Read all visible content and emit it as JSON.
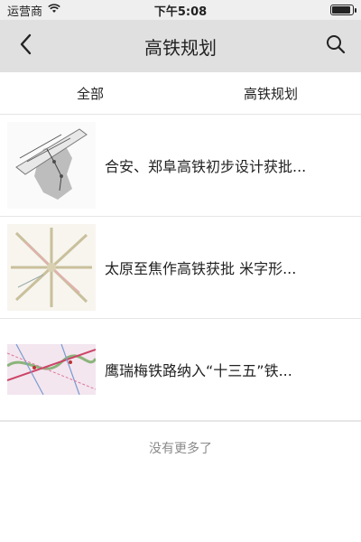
{
  "status_bar": {
    "carrier": "运营商",
    "time": "下午5:08"
  },
  "navbar": {
    "title": "高铁规划",
    "back_icon": "chevron-left-icon",
    "search_icon": "search-icon"
  },
  "tabs": [
    {
      "label": "全部"
    },
    {
      "label": "高铁规划"
    }
  ],
  "articles": [
    {
      "title": "合安、郑阜高铁初步设计获批..."
    },
    {
      "title": "太原至焦作高铁获批 米字形..."
    },
    {
      "title": "鹰瑞梅铁路纳入“十三五”铁..."
    }
  ],
  "footer": {
    "no_more": "没有更多了"
  }
}
